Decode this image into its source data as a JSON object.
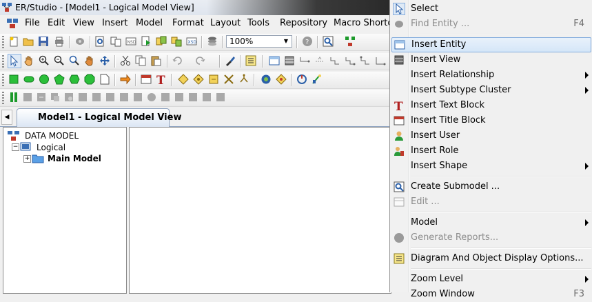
{
  "window": {
    "title": "ER/Studio - [Model1 - Logical Model View]"
  },
  "menubar": [
    {
      "label": "File",
      "name": "menu-file"
    },
    {
      "label": "Edit",
      "name": "menu-edit"
    },
    {
      "label": "View",
      "name": "menu-view"
    },
    {
      "label": "Insert",
      "name": "menu-insert"
    },
    {
      "label": "Model",
      "name": "menu-model"
    },
    {
      "label": "Format",
      "name": "menu-format"
    },
    {
      "label": "Layout",
      "name": "menu-layout"
    },
    {
      "label": "Tools",
      "name": "menu-tools"
    },
    {
      "label": "Repository",
      "name": "menu-repository"
    },
    {
      "label": "Macro Shortc",
      "name": "menu-macro-shortcuts"
    }
  ],
  "toolbar": {
    "zoom_value": "100%"
  },
  "tabs": {
    "active_label": "Model1 - Logical Model View"
  },
  "explorer": {
    "root": "DATA MODEL",
    "logical": "Logical",
    "main_model": "Main Model"
  },
  "context_menu": {
    "items": [
      {
        "label": "Select",
        "shortcut": "",
        "icon": "pointer-arrow-icon",
        "disabled": false,
        "submenu": false,
        "highlighted": false
      },
      {
        "label": "Find Entity ...",
        "shortcut": "F4",
        "icon": "find-entity-icon",
        "disabled": true,
        "submenu": false,
        "highlighted": false
      },
      {
        "label": "Insert Entity",
        "shortcut": "",
        "icon": "entity-icon",
        "disabled": false,
        "submenu": false,
        "highlighted": true
      },
      {
        "label": "Insert View",
        "shortcut": "",
        "icon": "view-icon",
        "disabled": false,
        "submenu": false,
        "highlighted": false
      },
      {
        "label": "Insert Relationship",
        "shortcut": "",
        "icon": "",
        "disabled": false,
        "submenu": true,
        "highlighted": false
      },
      {
        "label": "Insert Subtype Cluster",
        "shortcut": "",
        "icon": "",
        "disabled": false,
        "submenu": true,
        "highlighted": false
      },
      {
        "label": "Insert Text Block",
        "shortcut": "",
        "icon": "text-block-icon",
        "disabled": false,
        "submenu": false,
        "highlighted": false
      },
      {
        "label": "Insert Title Block",
        "shortcut": "",
        "icon": "title-block-icon",
        "disabled": false,
        "submenu": false,
        "highlighted": false
      },
      {
        "label": "Insert User",
        "shortcut": "",
        "icon": "user-icon",
        "disabled": false,
        "submenu": false,
        "highlighted": false
      },
      {
        "label": "Insert Role",
        "shortcut": "",
        "icon": "role-icon",
        "disabled": false,
        "submenu": false,
        "highlighted": false
      },
      {
        "label": "Insert Shape",
        "shortcut": "",
        "icon": "",
        "disabled": false,
        "submenu": true,
        "highlighted": false
      },
      {
        "label": "Create Submodel ...",
        "shortcut": "",
        "icon": "submodel-icon",
        "disabled": false,
        "submenu": false,
        "highlighted": false
      },
      {
        "label": "Edit ...",
        "shortcut": "",
        "icon": "edit-icon",
        "disabled": true,
        "submenu": false,
        "highlighted": false
      },
      {
        "label": "Model",
        "shortcut": "",
        "icon": "",
        "disabled": false,
        "submenu": true,
        "highlighted": false
      },
      {
        "label": "Generate Reports...",
        "shortcut": "",
        "icon": "generate-reports-icon",
        "disabled": true,
        "submenu": false,
        "highlighted": false
      },
      {
        "label": "Diagram And Object Display Options...",
        "shortcut": "",
        "icon": "display-options-icon",
        "disabled": false,
        "submenu": false,
        "highlighted": false
      },
      {
        "label": "Zoom Level",
        "shortcut": "",
        "icon": "",
        "disabled": false,
        "submenu": true,
        "highlighted": false
      },
      {
        "label": "Zoom Window",
        "shortcut": "F3",
        "icon": "",
        "disabled": false,
        "submenu": false,
        "highlighted": false
      }
    ]
  }
}
